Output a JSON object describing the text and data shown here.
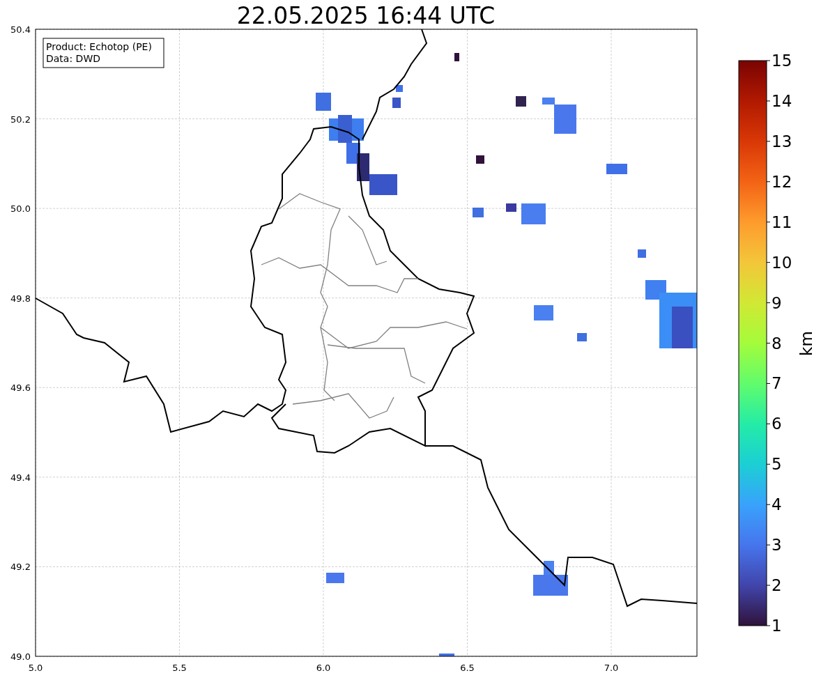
{
  "title": "22.05.2025 16:44 UTC",
  "info_box": {
    "lines": [
      "Product: Echotop (PE)",
      "Data: DWD"
    ]
  },
  "map": {
    "yticks": [
      "50.4",
      "50.2",
      "50.0",
      "49.8",
      "49.6",
      "49.4",
      "49.2",
      "49.0"
    ],
    "xticks": [
      "5.0",
      "5.5",
      "6.0",
      "6.5",
      "7.0"
    ]
  },
  "colorbar": {
    "ticks": [
      "15",
      "14",
      "13",
      "12",
      "11",
      "10",
      "9",
      "8",
      "7",
      "6",
      "5",
      "4",
      "3",
      "2",
      "1"
    ],
    "label": "km"
  }
}
